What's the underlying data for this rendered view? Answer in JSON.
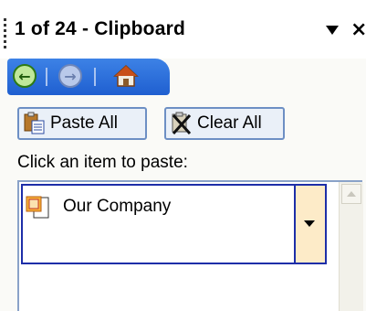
{
  "taskpane": {
    "title": "1 of 24 - Clipboard",
    "close_glyph": "×",
    "menu_icon": "chevron-down-icon"
  },
  "nav": {
    "back_icon": "back-arrow-icon",
    "forward_icon": "forward-arrow-icon",
    "home_icon": "home-icon",
    "back_glyph": "←",
    "forward_glyph": "→"
  },
  "actions": {
    "paste_all_label": "Paste All",
    "clear_all_label": "Clear All"
  },
  "instruction": "Click an item to paste:",
  "clipboard_items": [
    {
      "label": "Our Company",
      "icon": "powerpoint-document-icon"
    }
  ],
  "colors": {
    "nav_bar": "#1f5fd0",
    "button_border": "#6d8fc4",
    "item_border": "#1d2ea8",
    "item_dropdown_bg": "#fdebc8"
  }
}
